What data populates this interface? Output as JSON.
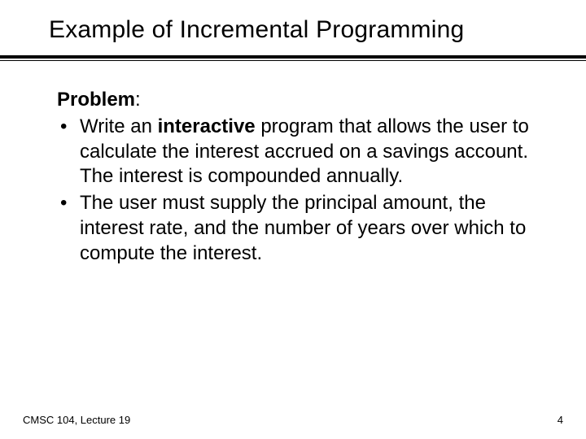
{
  "title": "Example of Incremental Programming",
  "heading_bold": "Problem",
  "heading_colon": ":",
  "bullet1_pre": "Write an ",
  "bullet1_bold": "interactive",
  "bullet1_post": " program that allows the user to calculate the interest accrued on a savings account.  The interest is compounded annually.",
  "bullet2": "The user must supply the principal amount, the interest rate, and the number of years over which to compute the interest.",
  "footer_left": "CMSC 104, Lecture 19",
  "footer_right": "4"
}
